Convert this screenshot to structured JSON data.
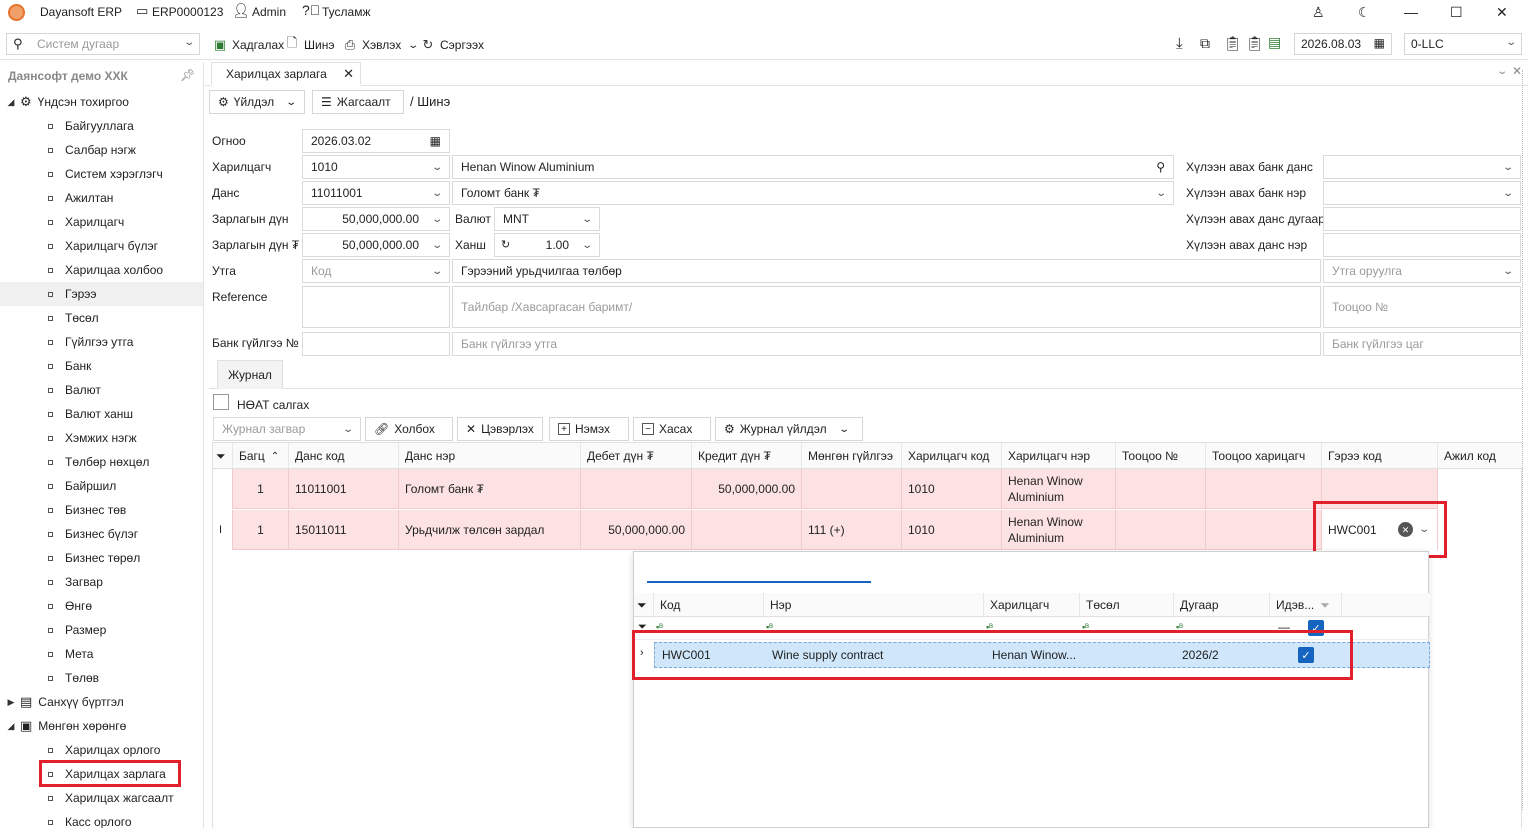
{
  "title_bar": {
    "app_name": "Dayansoft ERP",
    "doc_code": "ERP0000123",
    "user": "Admin",
    "help": "Тусламж"
  },
  "toolbar": {
    "search_placeholder": "Систем дугаар",
    "save": "Хадгалах",
    "new": "Шинэ",
    "print": "Хэвлэх",
    "refresh": "Сэргээх",
    "date": "2026.08.03",
    "company": "0-LLC"
  },
  "sidebar": {
    "company_name": "Даянсофт демо ХХК",
    "groups": [
      {
        "label": "Үндсэн тохиргоо",
        "expanded": true
      },
      {
        "label": "Санхүү бүртгэл",
        "expanded": false
      },
      {
        "label": "Мөнгөн хөрөнгө",
        "expanded": true
      }
    ],
    "main_items": [
      "Байгууллага",
      "Салбар нэгж",
      "Систем хэрэглэгч",
      "Ажилтан",
      "Харилцагч",
      "Харилцагч бүлэг",
      "Харилцаа холбоо",
      "Гэрээ",
      "Төсөл",
      "Гүйлгээ утга",
      "Банк",
      "Валют",
      "Валют ханш",
      "Хэмжих нэгж",
      "Төлбөр нөхцөл",
      "Байршил",
      "Бизнес төв",
      "Бизнес бүлэг",
      "Бизнес төрөл",
      "Загвар",
      "Өнгө",
      "Размер",
      "Мета",
      "Төлөв"
    ],
    "cash_items": [
      "Харилцах орлого",
      "Харилцах зарлага",
      "Харилцах жагсаалт",
      "Касс орлого"
    ]
  },
  "tab": {
    "label": "Харилцах зарлага"
  },
  "actions": {
    "operation": "Үйлдэл",
    "list": "Жагсаалт",
    "breadcrumb": "/ Шинэ"
  },
  "form": {
    "date_label": "Огноо",
    "date_value": "2026.03.02",
    "partner_label": "Харилцагч",
    "partner_code": "1010",
    "partner_name": "Henan Winow Aluminium",
    "account_label": "Данс",
    "account_code": "11011001",
    "account_name": "Голомт банк ₮",
    "amount_label": "Зарлагын дүн",
    "amount_value": "50,000,000.00",
    "amount_mnt_label": "Зарлагын дүн ₮",
    "amount_mnt_value": "50,000,000.00",
    "currency_label": "Валют",
    "currency_value": "MNT",
    "rate_label": "Ханш",
    "rate_value": "1.00",
    "purpose_label": "Утга",
    "purpose_code_placeholder": "Код",
    "purpose_text": "Гэрээний урьдчилгаа төлбөр",
    "purpose_input_placeholder": "Утга оруулга",
    "reference_label": "Reference",
    "note_placeholder": "Тайлбар /Хавсаргасан баримт/",
    "calc_no_placeholder": "Тооцоо №",
    "bank_txn_label": "Банк гүйлгээ №",
    "bank_txn_purpose_placeholder": "Банк гүйлгээ утга",
    "bank_txn_time_placeholder": "Банк гүйлгээ цаг",
    "recv_bank_account_label": "Хүлээн авах банк данс",
    "recv_bank_name_label": "Хүлээн авах банк нэр",
    "recv_account_no_label": "Хүлээн авах данс дугаар",
    "recv_account_name_label": "Хүлээн авах данс нэр"
  },
  "journal": {
    "tab": "Журнал",
    "vat_label": "НӨАТ салгах",
    "template_placeholder": "Журнал загвар",
    "link": "Холбох",
    "clear": "Цэвэрлэх",
    "add": "Нэмэх",
    "remove": "Хасах",
    "journal_action": "Журнал үйлдэл",
    "columns": [
      "Багц",
      "Данс код",
      "Данс нэр",
      "Дебет дүн ₮",
      "Кредит дүн ₮",
      "Мөнгөн гүйлгээ",
      "Харилцагч код",
      "Харилцагч нэр",
      "Тооцоо №",
      "Тооцоо харицагч",
      "Гэрээ код",
      "Ажил код"
    ],
    "rows": [
      {
        "batch": "1",
        "account_code": "11011001",
        "account_name": "Голомт банк ₮",
        "debit": "",
        "credit": "50,000,000.00",
        "cash_flow": "",
        "partner_code": "1010",
        "partner_name": "Henan Winow Aluminium",
        "contract": ""
      },
      {
        "batch": "1",
        "account_code": "15011011",
        "account_name": "Урьдчилж төлсөн зардал",
        "debit": "50,000,000.00",
        "credit": "",
        "cash_flow": "111 (+)",
        "partner_code": "1010",
        "partner_name": "Henan Winow Aluminium",
        "contract": "HWC001"
      }
    ]
  },
  "contract_popup": {
    "columns": [
      "Код",
      "Нэр",
      "Харилцагч",
      "Төсөл",
      "Дугаар",
      "Идэв..."
    ],
    "row": {
      "code": "HWC001",
      "name": "Wine supply contract",
      "partner": "Henan Winow...",
      "project": "",
      "number": "2026/2"
    }
  },
  "colors": {
    "highlight_red": "#e2202b",
    "row_pink": "#fde2e3",
    "select_blue": "#cfe6fb",
    "check_blue": "#1565c0"
  }
}
